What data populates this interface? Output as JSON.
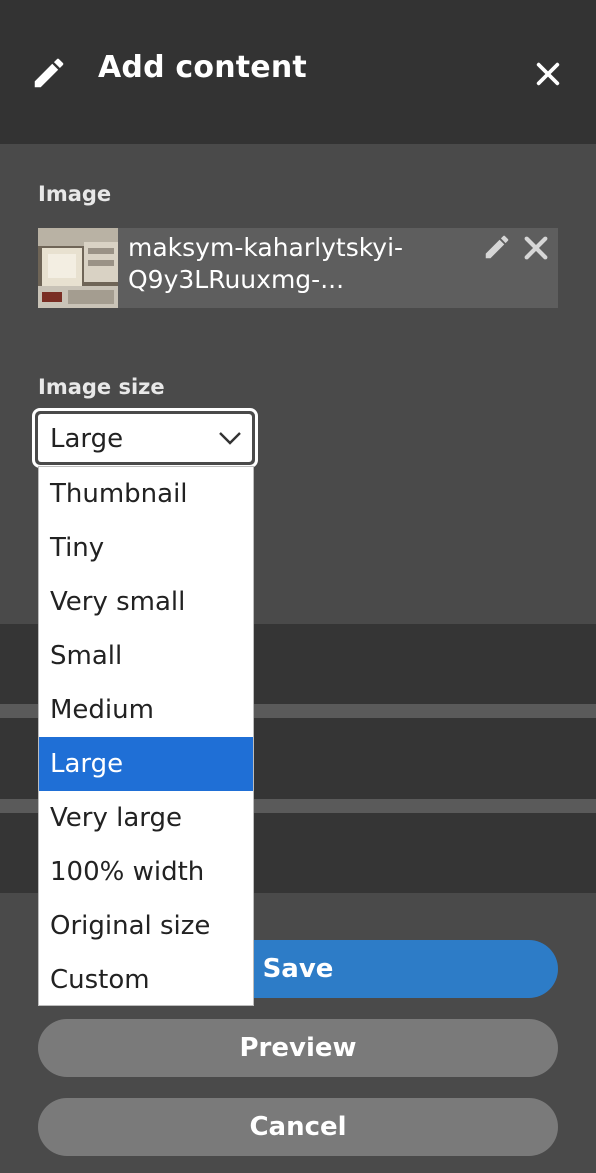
{
  "header": {
    "title": "Add content",
    "icon": "pencil-icon",
    "close_icon": "close-icon"
  },
  "image_field": {
    "label": "Image",
    "file_name_line1": "maksym-kaharlytskyi-",
    "file_name_line2": "Q9y3LRuuxmg-...",
    "edit_icon": "pencil-icon",
    "remove_icon": "remove-icon"
  },
  "image_size": {
    "label": "Image size",
    "selected": "Large",
    "options": [
      "Thumbnail",
      "Tiny",
      "Very small",
      "Small",
      "Medium",
      "Large",
      "Very large",
      "100% width",
      "Original size",
      "Custom"
    ]
  },
  "buttons": {
    "save": "Save",
    "preview": "Preview",
    "cancel": "Cancel"
  },
  "colors": {
    "accent": "#2d7cc7",
    "selection": "#1f6fd6",
    "topbar": "#333333",
    "panel": "#4a4a4a",
    "secondary_button": "#7a7a7a"
  }
}
